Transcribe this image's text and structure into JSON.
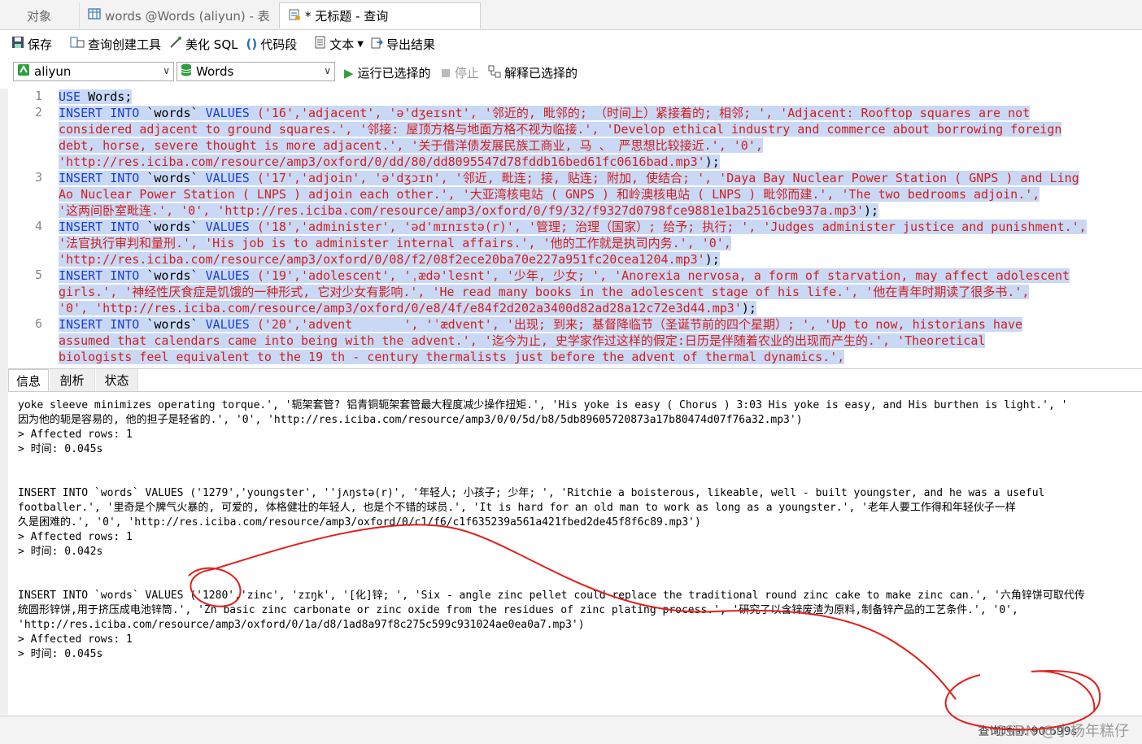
{
  "tabs": [
    {
      "label": "对象"
    },
    {
      "label": "words @Words (aliyun) - 表"
    },
    {
      "label": "* 无标题 - 查询"
    }
  ],
  "toolbar": {
    "save": "保存",
    "query_builder": "查询创建工具",
    "beautify": "美化 SQL",
    "snippet": "代码段",
    "text": "文本",
    "export": "导出结果"
  },
  "connection": {
    "selected": "aliyun"
  },
  "database": {
    "selected": "Words"
  },
  "actions": {
    "run": "运行已选择的",
    "stop": "停止",
    "explain": "解释已选择的"
  },
  "editor": {
    "line_numbers": [
      "1",
      "2",
      "3",
      "4",
      "5",
      "6"
    ],
    "lines": [
      [
        {
          "t": "USE ",
          "c": "kw"
        },
        {
          "t": "Words;",
          "c": ""
        }
      ],
      [
        {
          "t": "INSERT INTO ",
          "c": "kw"
        },
        {
          "t": "`words` ",
          "c": ""
        },
        {
          "t": "VALUES ",
          "c": "kw"
        },
        {
          "t": "('16','adjacent', 'ə'dʒeɪsnt', '邻近的, 毗邻的; （时间上）紧接着的; 相邻; ', 'Adjacent: Rooftop squares are not",
          "c": "st"
        }
      ],
      [
        {
          "t": "considered adjacent to ground squares.', '邻接: 屋顶方格与地面方格不视为临接.', 'Develop ethical industry and commerce about borrowing foreign",
          "c": "st"
        }
      ],
      [
        {
          "t": "debt, horse, severe thought is more adjacent.', '关于借洋债发展民族工商业, 马 、 严思想比较接近.', '0',",
          "c": "st"
        }
      ],
      [
        {
          "t": "'http://res.iciba.com/resource/amp3/oxford/0/dd/80/dd8095547d78fddb16bed61fc0616bad.mp3'",
          "c": "st"
        },
        {
          "t": ");",
          "c": ""
        }
      ],
      [
        {
          "t": "INSERT INTO ",
          "c": "kw"
        },
        {
          "t": "`words` ",
          "c": ""
        },
        {
          "t": "VALUES ",
          "c": "kw"
        },
        {
          "t": "('17','adjoin', 'ə'dʒɔɪn', '邻近, 毗连; 接, 贴连; 附加, 使结合; ', 'Daya Bay Nuclear Power Station ( GNPS ) and Ling",
          "c": "st"
        }
      ],
      [
        {
          "t": "Ao Nuclear Power Station ( LNPS ) adjoin each other.', '大亚湾核电站 ( GNPS ) 和岭澳核电站 ( LNPS ) 毗邻而建.', 'The two bedrooms adjoin.',",
          "c": "st"
        }
      ],
      [
        {
          "t": "'这两间卧室毗连.', '0', 'http://res.iciba.com/resource/amp3/oxford/0/f9/32/f9327d0798fce9881e1ba2516cbe937a.mp3'",
          "c": "st"
        },
        {
          "t": ");",
          "c": ""
        }
      ],
      [
        {
          "t": "INSERT INTO ",
          "c": "kw"
        },
        {
          "t": "`words` ",
          "c": ""
        },
        {
          "t": "VALUES ",
          "c": "kw"
        },
        {
          "t": "('18','administer', 'əd'mɪnɪstə(r)', '管理; 治理（国家）; 给予; 执行; ', 'Judges administer justice and punishment.',",
          "c": "st"
        }
      ],
      [
        {
          "t": "'法官执行审判和量刑.', 'His job is to administer internal affairs.', '他的工作就是执司内务.', '0',",
          "c": "st"
        }
      ],
      [
        {
          "t": "'http://res.iciba.com/resource/amp3/oxford/0/08/f2/08f2ece20ba70e227a951fc20cea1204.mp3'",
          "c": "st"
        },
        {
          "t": ");",
          "c": ""
        }
      ],
      [
        {
          "t": "INSERT INTO ",
          "c": "kw"
        },
        {
          "t": "`words` ",
          "c": ""
        },
        {
          "t": "VALUES ",
          "c": "kw"
        },
        {
          "t": "('19','adolescent', 'ˌædə'lesnt', '少年, 少女; ', 'Anorexia nervosa, a form of starvation, may affect adolescent",
          "c": "st"
        }
      ],
      [
        {
          "t": "girls.', '神经性厌食症是饥饿的一种形式, 它对少女有影响.', 'He read many books in the adolescent stage of his life.', '他在青年时期读了很多书.',",
          "c": "st"
        }
      ],
      [
        {
          "t": "'0', 'http://res.iciba.com/resource/amp3/oxford/0/e8/4f/e84f2d202a3400d82ad28a12c72e3d44.mp3'",
          "c": "st"
        },
        {
          "t": ");",
          "c": ""
        }
      ],
      [
        {
          "t": "INSERT INTO ",
          "c": "kw"
        },
        {
          "t": "`words` ",
          "c": ""
        },
        {
          "t": "VALUES ",
          "c": "kw"
        },
        {
          "t": "('20','advent       ', 'ˈædvent', '出现; 到来; 基督降临节（圣诞节前的四个星期）; ', 'Up to now, historians have",
          "c": "st"
        }
      ],
      [
        {
          "t": "assumed that calendars came into being with the advent.', '迄今为止, 史学家作过这样的假定:日历是伴随着农业的出现而产生的.', 'Theoretical",
          "c": "st"
        }
      ],
      [
        {
          "t": "biologists feel equivalent to the 19 th - century thermalists just before the advent of thermal dynamics.',",
          "c": "st"
        }
      ]
    ]
  },
  "bottom_tabs": [
    "信息",
    "剖析",
    "状态"
  ],
  "output": {
    "lines": [
      "yoke sleeve minimizes operating torque.', '轭架套管? 铝青铜轭架套管最大程度减少操作扭矩.', 'His yoke is easy ( Chorus ) 3:03 His yoke is easy, and His burthen is light.', '",
      "因为他的轭是容易的, 他的担子是轻省的.', '0', 'http://res.iciba.com/resource/amp3/0/0/5d/b8/5db89605720873a17b80474d07f76a32.mp3')",
      "> Affected rows: 1",
      "> 时间: 0.045s",
      "",
      "",
      "INSERT INTO `words` VALUES ('1279','youngster', ''jʌŋstə(r)', '年轻人; 小孩子; 少年; ', 'Ritchie a boisterous, likeable, well - built youngster, and he was a useful",
      "footballer.', '里奇是个脾气火暴的, 可爱的, 体格健壮的年轻人, 也是个不错的球员.', 'It is hard for an old man to work as long as a youngster.', '老年人要工作得和年轻伙子一样",
      "久是困难的.', '0', 'http://res.iciba.com/resource/amp3/oxford/0/c1/f6/c1f635239a561a421fbed2de45f8f6c89.mp3')",
      "> Affected rows: 1",
      "> 时间: 0.042s",
      "",
      "",
      "INSERT INTO `words` VALUES ('1280','zinc', 'zɪŋk', '[化]锌; ', 'Six - angle zinc pellet could replace the traditional round zinc cake to make zinc can.', '六角锌饼可取代传",
      "统圆形锌饼,用于挤压成电池锌筒.', 'Zn basic zinc carbonate or zinc oxide from the residues of zinc plating process.', '研究了以含锌废渣为原料,制备锌产品的工艺条件.', '0',",
      "'http://res.iciba.com/resource/amp3/oxford/0/1a/d8/1ad8a97f8c275c599c931024ae0ea0a7.mp3')",
      "> Affected rows: 1",
      "> 时间: 0.045s"
    ]
  },
  "status": {
    "query_time": "查询时间: 90.699s",
    "watermark": "CSDN @小杨年糕仔"
  },
  "colors": {
    "keyword": "#1a3dd6",
    "string": "#d21f1f",
    "selection": "#c9d9f5",
    "annotation": "#e0201c"
  }
}
